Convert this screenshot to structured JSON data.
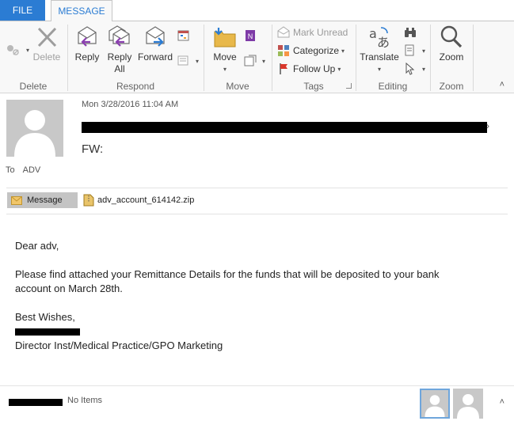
{
  "tabs": {
    "file": "FILE",
    "message": "MESSAGE"
  },
  "ribbon": {
    "delete_group": {
      "label": "Delete",
      "delete_btn": "Delete"
    },
    "respond_group": {
      "label": "Respond",
      "reply": "Reply",
      "reply_all_1": "Reply",
      "reply_all_2": "All",
      "forward": "Forward"
    },
    "move_group": {
      "label": "Move",
      "move": "Move"
    },
    "tags_group": {
      "label": "Tags",
      "mark_unread": "Mark Unread",
      "categorize": "Categorize",
      "follow_up": "Follow Up"
    },
    "editing_group": {
      "label": "Editing",
      "translate": "Translate"
    },
    "zoom_group": {
      "label": "Zoom",
      "zoom": "Zoom"
    }
  },
  "header": {
    "date": "Mon 3/28/2016 11:04 AM",
    "subject": "FW:",
    "to_label": "To",
    "to_value": "ADV"
  },
  "attachments": {
    "message_tab": "Message",
    "file_name": "adv_account_614142.zip"
  },
  "body": {
    "greeting": "Dear adv,",
    "para1_line1": "Please find attached your Remittance Details for the funds that will be deposited to your bank",
    "para1_line2": "account on March 28th.",
    "closing": "Best Wishes,",
    "title": "Director Inst/Medical Practice/GPO Marketing"
  },
  "people_pane": {
    "status": "No Items"
  },
  "colors": {
    "accent": "#2b7cd3",
    "ribbon_bg": "#f8f8f8",
    "photo_bg": "#c8c8c8"
  }
}
